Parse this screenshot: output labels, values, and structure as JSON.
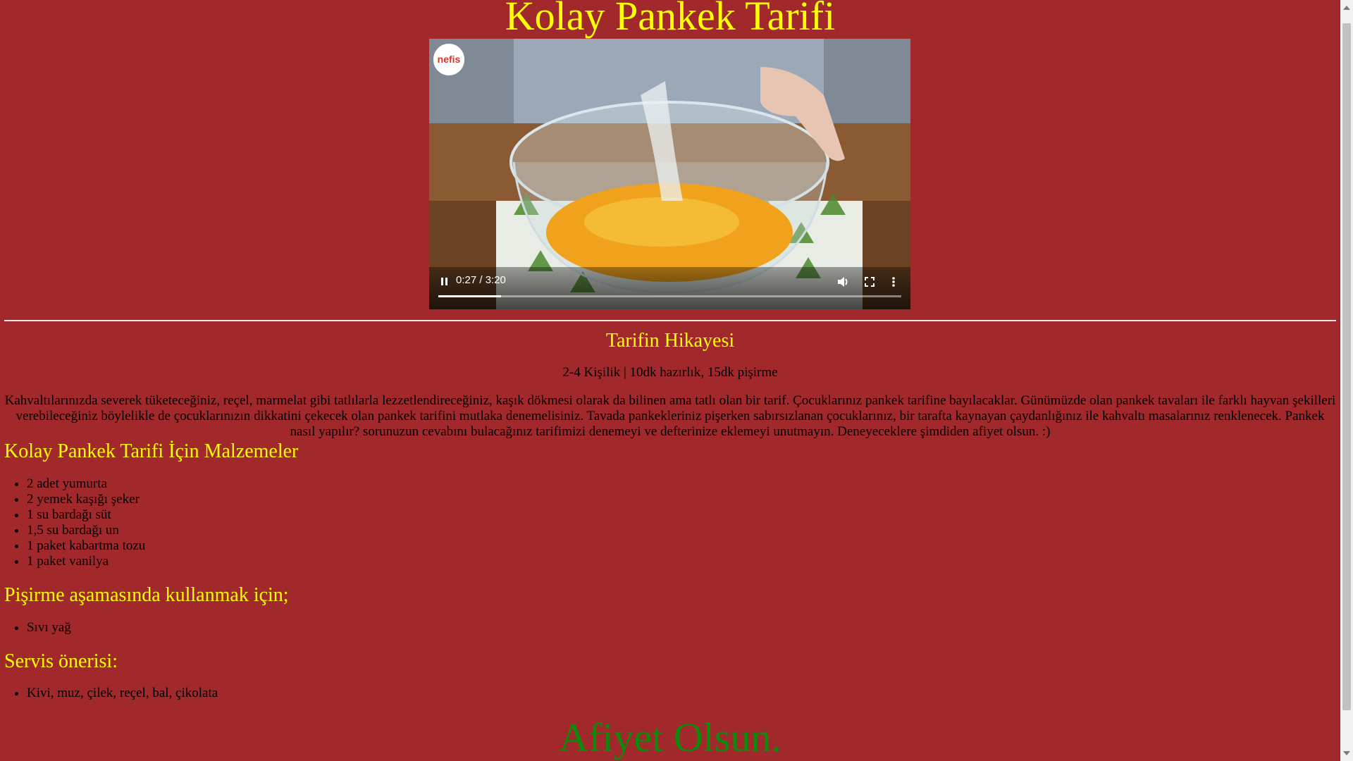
{
  "page": {
    "title": "Kolay Pankek Tarifi",
    "footer": "Afiyet Olsun."
  },
  "video": {
    "logo": "nefis",
    "time": "0:27 / 3:20",
    "progress_fraction": 0.135,
    "icons": [
      "pause-icon",
      "volume-icon",
      "fullscreen-icon",
      "more-options-icon"
    ]
  },
  "story": {
    "heading": "Tarifin Hikayesi",
    "meta": "2-4 Kişilik | 10dk hazırlık, 15dk pişirme",
    "text": "Kahvaltılarınızda severek tüketeceğiniz, reçel, marmelat gibi tatlılarla lezzetlendireceğiniz, kaşık dökmesi olarak da bilinen ama tatlı olan bir tarif. Çocuklarınız pankek tarifine bayılacaklar. Günümüzde olan pankek tavaları ile farklı hayvan şekilleri verebileceğiniz böylelikle de çocuklarınızın dikkatini çekecek olan pankek tarifini mutlaka denemelisiniz. Tavada pankekleriniz pişerken sabırsızlanan çocuklarınız, bir tarafta kaynayan çaydanlığınız ile kahvaltı masalarınız renklenecek. Pankek nasıl yapılır? sorunuzun cevabını bulacağınız tarifimizi denemeyi ve defterinize eklemeyi unutmayın. Deneyeceklere şimdiden afiyet olsun. :)"
  },
  "ingredients": {
    "heading": "Kolay Pankek Tarifi İçin Malzemeler",
    "items": [
      "2 adet yumurta",
      "2 yemek kaşığı şeker",
      "1 su bardağı süt",
      "1,5 su bardağı un",
      "1 paket kabartma tozu",
      "1 paket vanilya"
    ]
  },
  "cooking": {
    "heading": "Pişirme aşamasında kullanmak için;",
    "items": [
      "Sıvı yağ"
    ]
  },
  "serving": {
    "heading": "Servis önerisi:",
    "items": [
      "Kivi, muz, çilek, reçel, bal, çikolata"
    ]
  },
  "colors": {
    "background": "#a1292b",
    "heading": "#ffff00",
    "footer": "#0b8a0b"
  }
}
